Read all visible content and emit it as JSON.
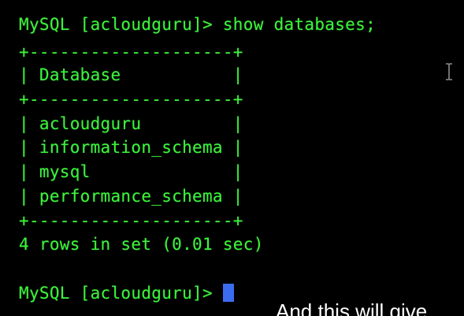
{
  "terminal": {
    "command_line": "MySQL [acloudguru]> show databases;",
    "table": {
      "border_top": "+--------------------+",
      "header_row": "| Database           |",
      "border_mid": "+--------------------+",
      "rows": [
        "| acloudguru         |",
        "| information_schema |",
        "| mysql              |",
        "| performance_schema |"
      ],
      "border_bottom": "+--------------------+"
    },
    "result_summary": "4 rows in set (0.01 sec)",
    "prompt": "MySQL [acloudguru]> ",
    "colors": {
      "background": "#000000",
      "text": "#3cf23c",
      "cursor": "#3b6cf0"
    },
    "pointer_icon": "text-cursor-ibeam-icon"
  },
  "caption": {
    "text": "And this will give"
  }
}
